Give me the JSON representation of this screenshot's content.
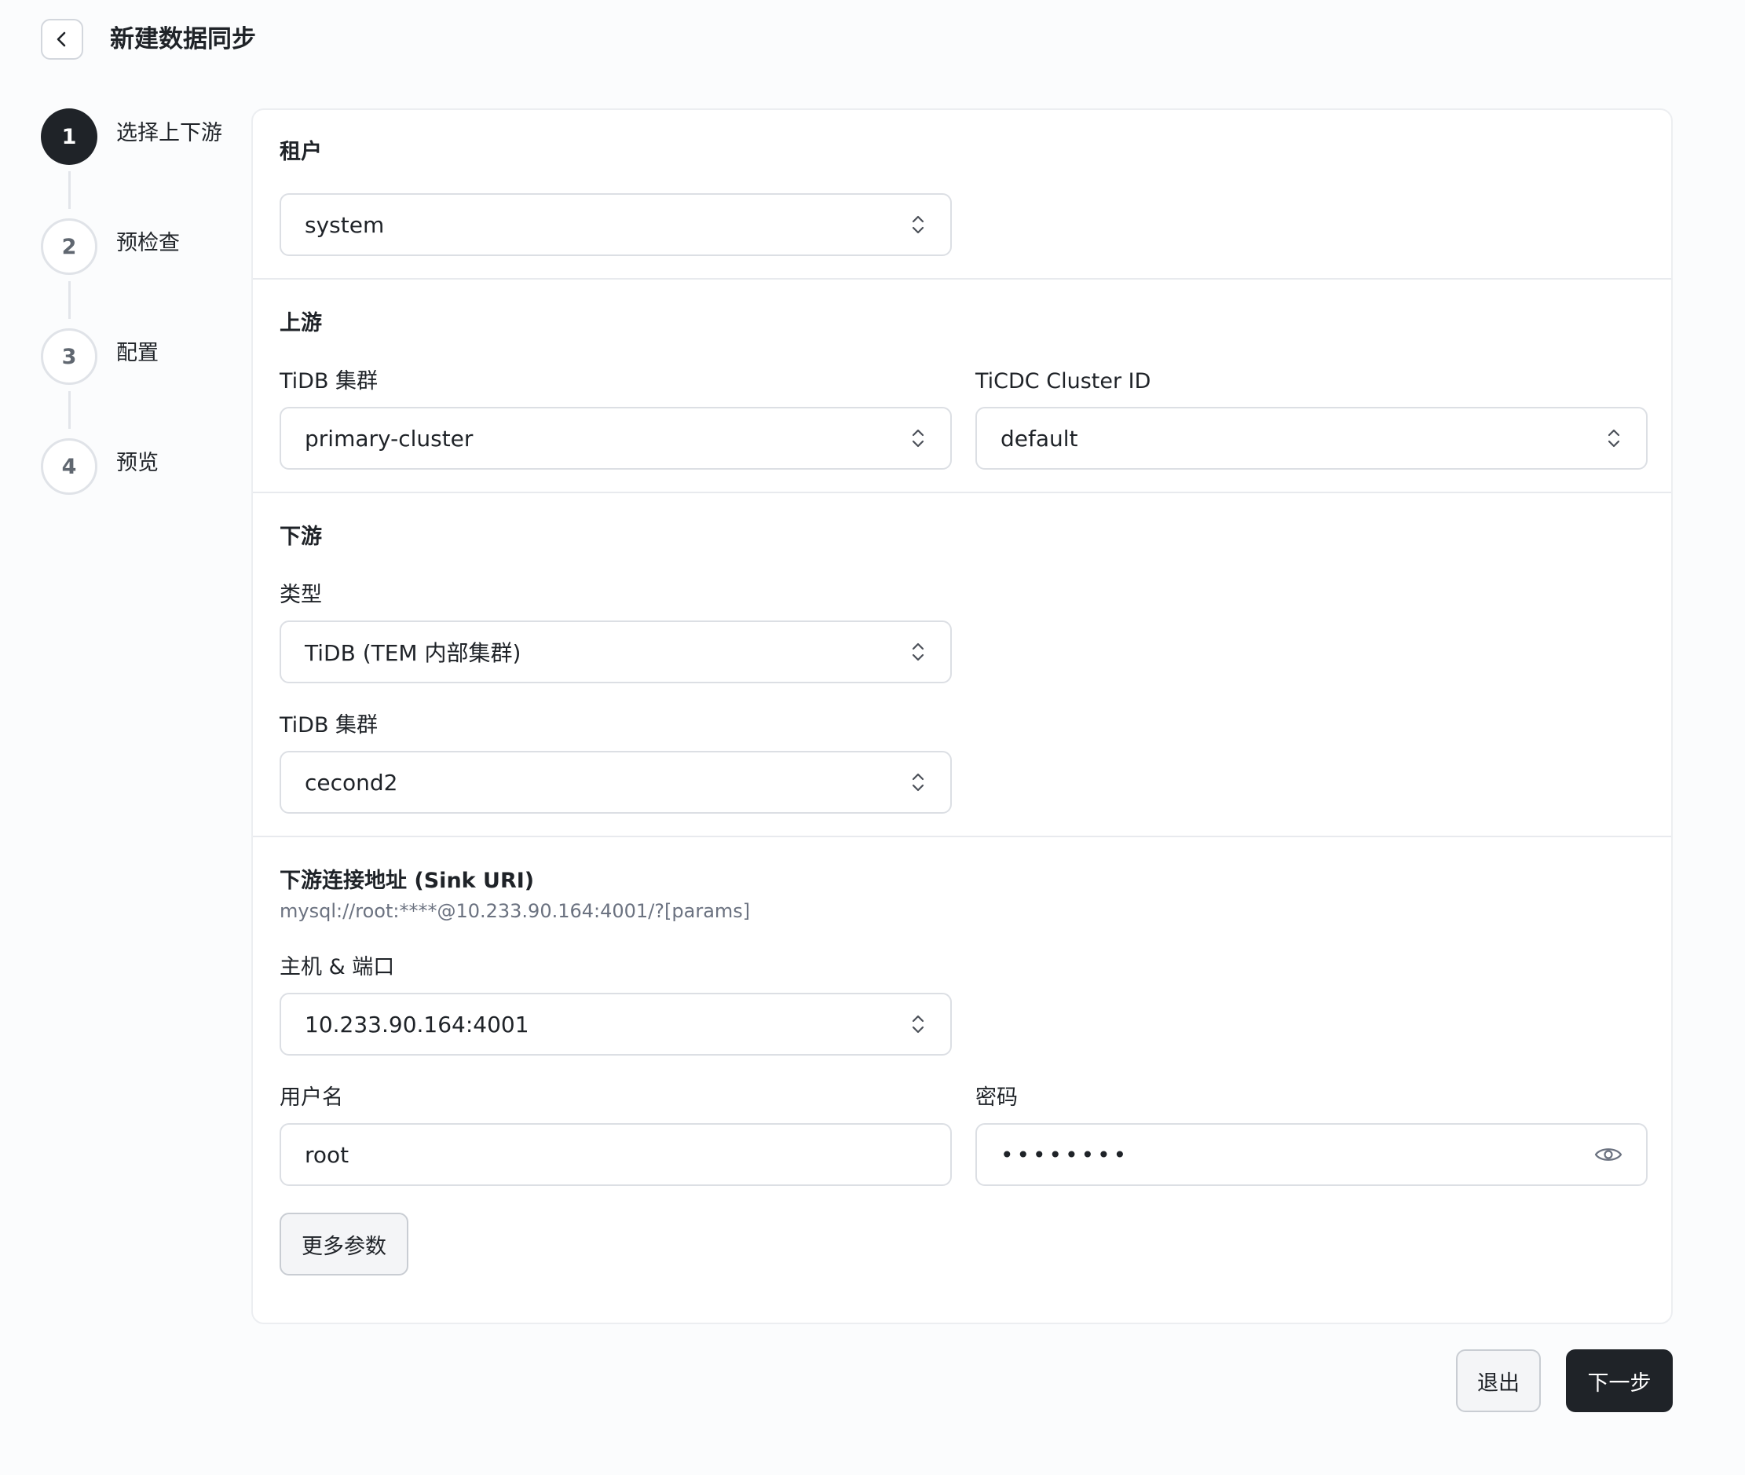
{
  "header": {
    "title": "新建数据同步",
    "back_icon": "chevron-left-icon"
  },
  "steps": [
    {
      "number": "1",
      "label": "选择上下游",
      "state": "active"
    },
    {
      "number": "2",
      "label": "预检查",
      "state": "pending"
    },
    {
      "number": "3",
      "label": "配置",
      "state": "pending"
    },
    {
      "number": "4",
      "label": "预览",
      "state": "pending"
    }
  ],
  "tenant": {
    "section_title": "租户",
    "value": "system"
  },
  "upstream": {
    "section_title": "上游",
    "cluster_label": "TiDB 集群",
    "cluster_value": "primary-cluster",
    "cdc_label": "TiCDC Cluster ID",
    "cdc_value": "default"
  },
  "downstream": {
    "section_title": "下游",
    "type_label": "类型",
    "type_value": "TiDB (TEM 内部集群)",
    "cluster_label": "TiDB 集群",
    "cluster_value": "cecond2"
  },
  "sink": {
    "section_title": "下游连接地址 (Sink URI)",
    "uri_hint": "mysql://root:****@10.233.90.164:4001/?[params]",
    "host_label": "主机 & 端口",
    "host_value": "10.233.90.164:4001",
    "username_label": "用户名",
    "username_value": "root",
    "password_label": "密码",
    "password_value": "••••••••",
    "password_icon": "eye-icon",
    "more_params_label": "更多参数"
  },
  "footer": {
    "exit_label": "退出",
    "next_label": "下一步"
  },
  "colors": {
    "primary": "#1f2328",
    "border": "#dcdfe4",
    "muted_text": "#6b7280",
    "background": "#fbfcfd"
  }
}
